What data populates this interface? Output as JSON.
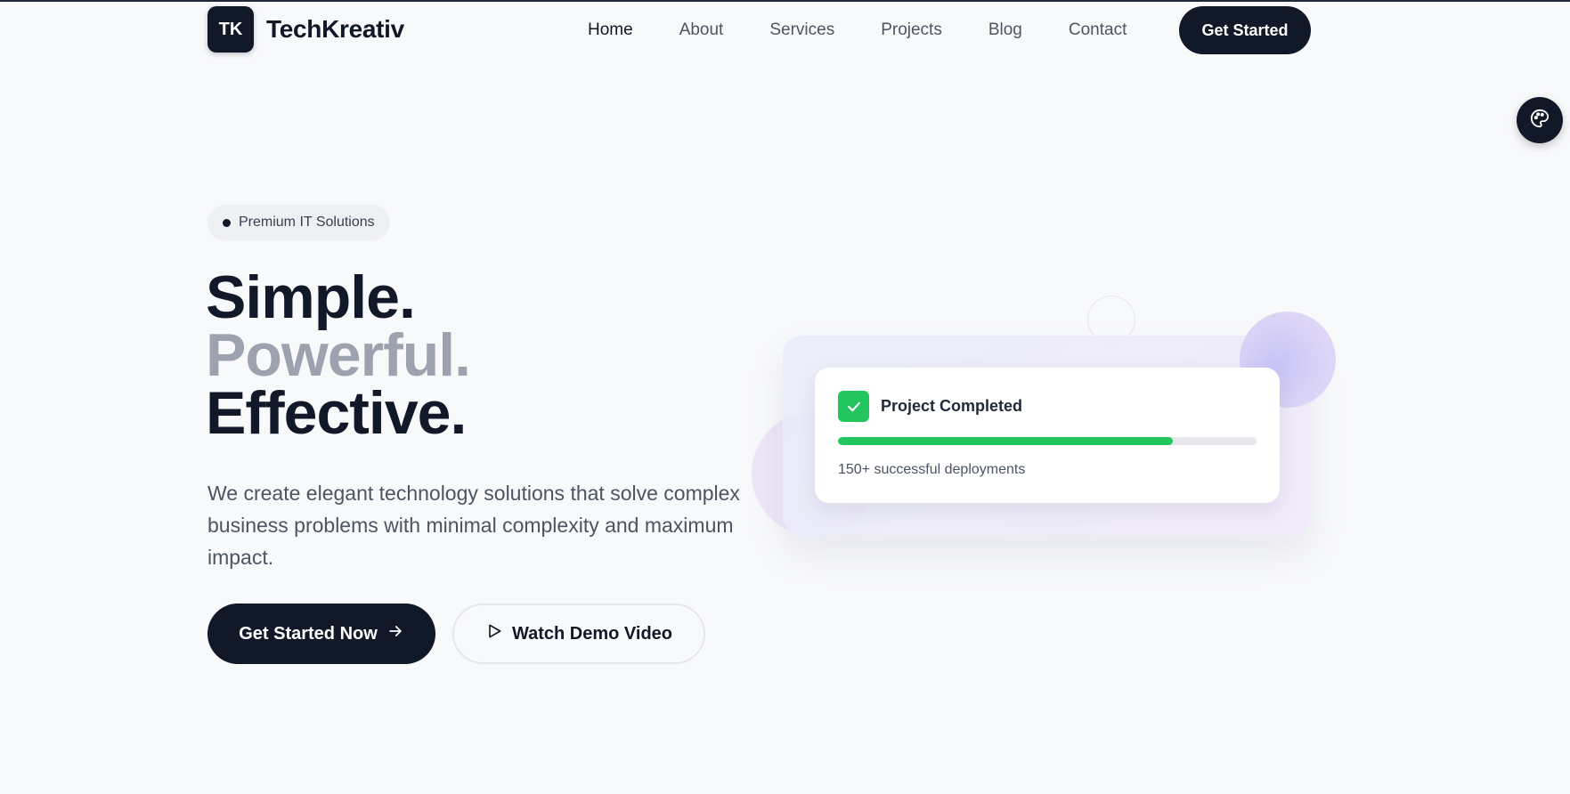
{
  "brand": {
    "logo_mark": "TK",
    "name": "TechKreativ"
  },
  "nav": {
    "items": [
      {
        "label": "Home",
        "active": true
      },
      {
        "label": "About",
        "active": false
      },
      {
        "label": "Services",
        "active": false
      },
      {
        "label": "Projects",
        "active": false
      },
      {
        "label": "Blog",
        "active": false
      },
      {
        "label": "Contact",
        "active": false
      }
    ],
    "cta_label": "Get Started"
  },
  "theme_toggle": {
    "icon": "palette-icon"
  },
  "hero": {
    "badge": "Premium IT Solutions",
    "headline": {
      "line1": "Simple.",
      "line2": "Powerful.",
      "line3": "Effective."
    },
    "lead": "We create elegant technology solutions that solve complex business problems with minimal complexity and maximum impact.",
    "primary_button": {
      "label": "Get Started Now",
      "icon": "arrow-right-icon"
    },
    "secondary_button": {
      "label": "Watch Demo Video",
      "icon": "play-icon"
    }
  },
  "status_card": {
    "icon": "check-icon",
    "title": "Project Completed",
    "progress_percent": 80,
    "subtitle": "150+ successful deployments"
  },
  "colors": {
    "primary": "#111827",
    "muted_text": "#9ca3af",
    "success": "#22c55e",
    "background": "#f8f9fb"
  }
}
